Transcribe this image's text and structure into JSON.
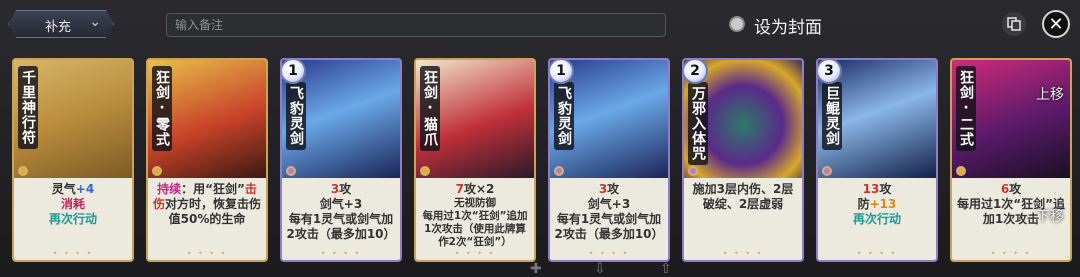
{
  "dropdown": {
    "label": "补充"
  },
  "notes": {
    "placeholder": "输入备注"
  },
  "cover": {
    "label": "设为封面"
  },
  "controls": {
    "copy_icon": "copy-icon",
    "close_icon": "close-icon",
    "close_glyph": "✕"
  },
  "cards": [
    {
      "name": "千里神行符",
      "level": "",
      "desc": [
        {
          "t": "灵气",
          "c": ""
        },
        {
          "t": "+4",
          "c": "c-blue"
        }
      ],
      "desc2": [
        {
          "t": "消耗",
          "c": "c-pink"
        }
      ],
      "desc3": [
        {
          "t": "再次行动",
          "c": "c-teal"
        }
      ]
    },
    {
      "name": "狂剑·零式",
      "level": "",
      "desc": [
        {
          "t": "持续",
          "c": "c-mag"
        },
        {
          "t": "：用“狂剑”",
          "c": ""
        },
        {
          "t": "击伤",
          "c": "c-red"
        },
        {
          "t": "对方时，恢复击伤值50%的生命",
          "c": ""
        }
      ]
    },
    {
      "name": "飞豹灵剑",
      "level": "1",
      "desc": [
        {
          "t": "3",
          "c": "c-red"
        },
        {
          "t": "攻",
          "c": ""
        }
      ],
      "desc2": [
        {
          "t": "剑气+3",
          "c": ""
        }
      ],
      "desc3": [
        {
          "t": "每有1灵气或剑气加2攻击（最多加10）",
          "c": ""
        }
      ]
    },
    {
      "name": "狂剑·猫爪",
      "level": "",
      "desc": [
        {
          "t": "7",
          "c": "c-red"
        },
        {
          "t": "攻×2",
          "c": ""
        }
      ],
      "desc2": [
        {
          "t": "无视防御",
          "c": ""
        }
      ],
      "desc3": [
        {
          "t": "每用过1次“狂剑”追加1次攻击（使用此牌算作2次“狂剑”）",
          "c": ""
        }
      ]
    },
    {
      "name": "飞豹灵剑",
      "level": "1",
      "desc": [
        {
          "t": "3",
          "c": "c-red"
        },
        {
          "t": "攻",
          "c": ""
        }
      ],
      "desc2": [
        {
          "t": "剑气+3",
          "c": ""
        }
      ],
      "desc3": [
        {
          "t": "每有1灵气或剑气加2攻击（最多加10）",
          "c": ""
        }
      ]
    },
    {
      "name": "万邪入体咒",
      "level": "2",
      "desc": [
        {
          "t": "施加3层内伤、2层破绽、2层虚弱",
          "c": ""
        }
      ]
    },
    {
      "name": "巨鲲灵剑",
      "level": "3",
      "desc": [
        {
          "t": "13",
          "c": "c-red"
        },
        {
          "t": "攻",
          "c": ""
        }
      ],
      "desc2": [
        {
          "t": "防",
          "c": ""
        },
        {
          "t": "+13",
          "c": "c-org"
        }
      ],
      "desc3": [
        {
          "t": "再次行动",
          "c": "c-teal"
        }
      ]
    },
    {
      "name": "狂剑·二式",
      "level": "",
      "desc": [
        {
          "t": "6",
          "c": "c-red"
        },
        {
          "t": "攻",
          "c": ""
        }
      ],
      "desc2": [
        {
          "t": "每用过1次“狂剑”追加1次攻击",
          "c": ""
        }
      ]
    }
  ],
  "move": {
    "up": "上移",
    "down": "下移"
  },
  "colors": {
    "accent_blue": "#3a64c8",
    "damage_red": "#c43a2a",
    "teal": "#1b9a96"
  }
}
